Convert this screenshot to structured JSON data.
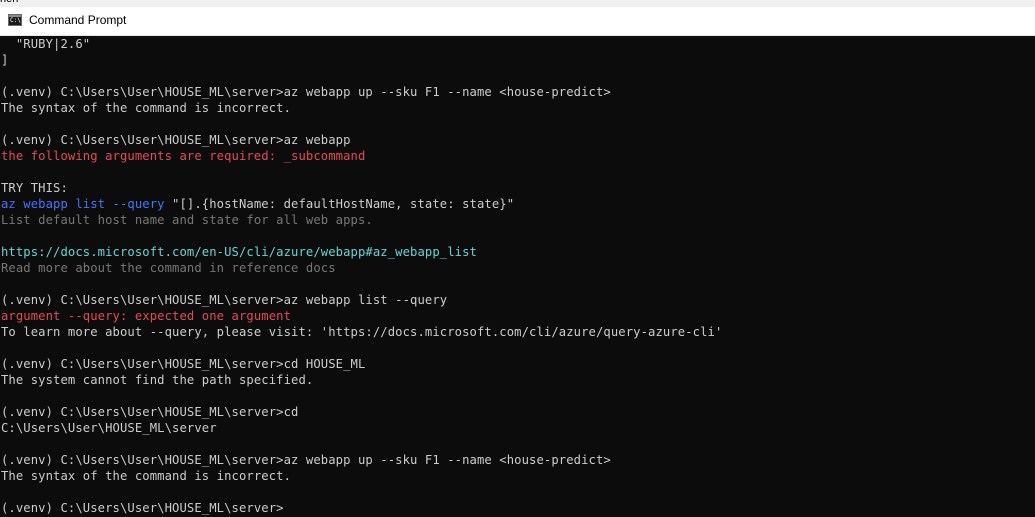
{
  "top_strip": {
    "text": "hen"
  },
  "window": {
    "title": "Command Prompt",
    "icon": "cmd-icon",
    "icon_glyph": "C:\\"
  },
  "colors": {
    "background": "#0c0c0c",
    "default_text": "#cccccc",
    "error_red": "#e74856",
    "link_cyan": "#61d6d6",
    "command_blue": "#3b78ff",
    "hint_gray": "#767676"
  },
  "console": {
    "lines": [
      [
        {
          "text": "  \"RUBY|2.6\"",
          "style": "default"
        }
      ],
      [
        {
          "text": "]",
          "style": "default"
        }
      ],
      [
        {
          "text": "",
          "style": "default"
        }
      ],
      [
        {
          "text": "(.venv) C:\\Users\\User\\HOUSE_ML\\server>az webapp up --sku F1 --name <house-predict>",
          "style": "default"
        }
      ],
      [
        {
          "text": "The syntax of the command is incorrect.",
          "style": "default"
        }
      ],
      [
        {
          "text": "",
          "style": "default"
        }
      ],
      [
        {
          "text": "(.venv) C:\\Users\\User\\HOUSE_ML\\server>az webapp",
          "style": "default"
        }
      ],
      [
        {
          "text": "the following arguments are required: _subcommand",
          "style": "red"
        }
      ],
      [
        {
          "text": "",
          "style": "default"
        }
      ],
      [
        {
          "text": "TRY THIS:",
          "style": "default"
        }
      ],
      [
        {
          "text": "az webapp list --query",
          "style": "blue"
        },
        {
          "text": " \"[].{hostName: defaultHostName, state: state}\"",
          "style": "default"
        }
      ],
      [
        {
          "text": "List default host name and state for all web apps.",
          "style": "gray"
        }
      ],
      [
        {
          "text": "",
          "style": "default"
        }
      ],
      [
        {
          "text": "https://docs.microsoft.com/en-US/cli/azure/webapp#az_webapp_list",
          "style": "cyan"
        }
      ],
      [
        {
          "text": "Read more about the command in reference docs",
          "style": "gray"
        }
      ],
      [
        {
          "text": "",
          "style": "default"
        }
      ],
      [
        {
          "text": "(.venv) C:\\Users\\User\\HOUSE_ML\\server>az webapp list --query",
          "style": "default"
        }
      ],
      [
        {
          "text": "argument --query: expected one argument",
          "style": "red"
        }
      ],
      [
        {
          "text": "To learn more about --query, please visit: 'https://docs.microsoft.com/cli/azure/query-azure-cli'",
          "style": "default"
        }
      ],
      [
        {
          "text": "",
          "style": "default"
        }
      ],
      [
        {
          "text": "(.venv) C:\\Users\\User\\HOUSE_ML\\server>cd HOUSE_ML",
          "style": "default"
        }
      ],
      [
        {
          "text": "The system cannot find the path specified.",
          "style": "default"
        }
      ],
      [
        {
          "text": "",
          "style": "default"
        }
      ],
      [
        {
          "text": "(.venv) C:\\Users\\User\\HOUSE_ML\\server>cd",
          "style": "default"
        }
      ],
      [
        {
          "text": "C:\\Users\\User\\HOUSE_ML\\server",
          "style": "default"
        }
      ],
      [
        {
          "text": "",
          "style": "default"
        }
      ],
      [
        {
          "text": "(.venv) C:\\Users\\User\\HOUSE_ML\\server>az webapp up --sku F1 --name <house-predict>",
          "style": "default"
        }
      ],
      [
        {
          "text": "The syntax of the command is incorrect.",
          "style": "default"
        }
      ],
      [
        {
          "text": "",
          "style": "default"
        }
      ],
      [
        {
          "text": "(.venv) C:\\Users\\User\\HOUSE_ML\\server>",
          "style": "default"
        }
      ]
    ]
  }
}
